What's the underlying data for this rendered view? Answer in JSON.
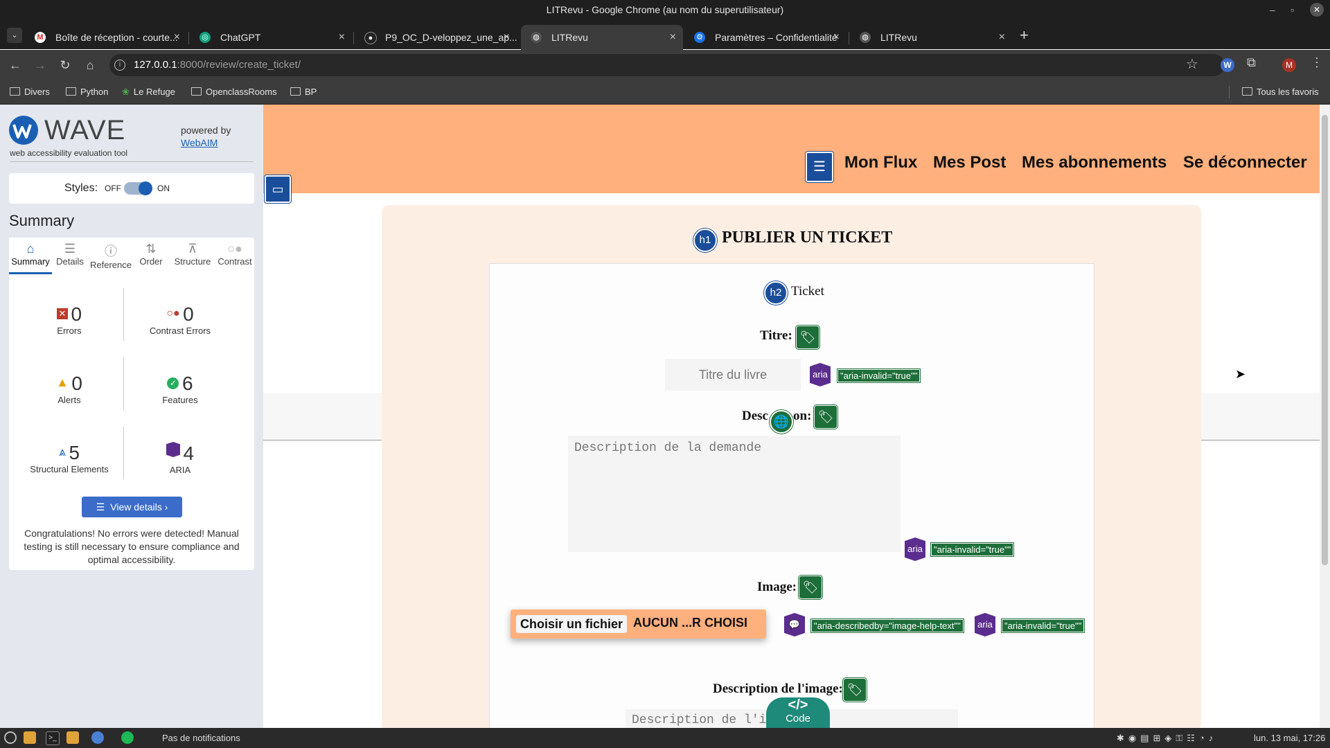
{
  "window": {
    "title": "LITRevu - Google Chrome (au nom du superutilisateur)"
  },
  "tabs": [
    {
      "label": "Boîte de réception - courte...",
      "icon": "gmail-icon"
    },
    {
      "label": "ChatGPT",
      "icon": "chatgpt-icon"
    },
    {
      "label": "P9_OC_D-veloppez_une_ap...",
      "icon": "github-icon"
    },
    {
      "label": "LITRevu",
      "icon": "globe-icon",
      "active": true
    },
    {
      "label": "Paramètres – Confidentialité",
      "icon": "gear-icon"
    },
    {
      "label": "LITRevu",
      "icon": "globe-icon"
    }
  ],
  "toolbar": {
    "url_host": "127.0.0.1",
    "url_path": ":8000/review/create_ticket/"
  },
  "bookmarks": [
    "Divers",
    "Python",
    "Le Refuge",
    "OpenclassRooms",
    "BP"
  ],
  "bookmarks_all": "Tous les favoris",
  "wave": {
    "logo": "WAVE",
    "tagline": "web accessibility evaluation tool",
    "powered_by": "powered by",
    "webaim": "WebAIM",
    "styles_label": "Styles:",
    "off": "OFF",
    "on": "ON",
    "summary_title": "Summary",
    "tabs": [
      "Summary",
      "Details",
      "Reference",
      "Order",
      "Structure",
      "Contrast"
    ],
    "stats": {
      "errors": {
        "value": "0",
        "label": "Errors"
      },
      "contrast": {
        "value": "0",
        "label": "Contrast Errors"
      },
      "alerts": {
        "value": "0",
        "label": "Alerts"
      },
      "features": {
        "value": "6",
        "label": "Features"
      },
      "structural": {
        "value": "5",
        "label": "Structural Elements"
      },
      "aria": {
        "value": "4",
        "label": "ARIA"
      }
    },
    "view_details": "View details ›",
    "congrats": "Congratulations! No errors were detected! Manual testing is still necessary to ensure compliance and optimal accessibility."
  },
  "site_nav": [
    "Mon Flux",
    "Mes Post",
    "Mes abonnements",
    "Se déconnecter"
  ],
  "form": {
    "h1_badge": "h1",
    "title": "PUBLIER UN TICKET",
    "h2_badge": "h2",
    "subtitle": "Ticket",
    "titre_label": "Titre:",
    "titre_placeholder": "Titre du livre",
    "aria_label": "aria",
    "aria_invalid": "\"aria-invalid=\"true\"\"",
    "description_label": "Desc",
    "description_label_end": "on:",
    "description_placeholder": "Description de la demande",
    "image_label": "Image:",
    "choose_file": "Choisir un fichier",
    "no_file": "AUCUN ...R CHOISI",
    "aria_describedby": "\"aria-describedby=\"image-help-text\"\"",
    "image_desc_label": "Description de l'image:",
    "image_desc_placeholder": "Description de l'i",
    "code_label": "Code"
  },
  "taskbar": {
    "notifications": "Pas de notifications",
    "clock": "lun. 13 mai, 17:26"
  }
}
